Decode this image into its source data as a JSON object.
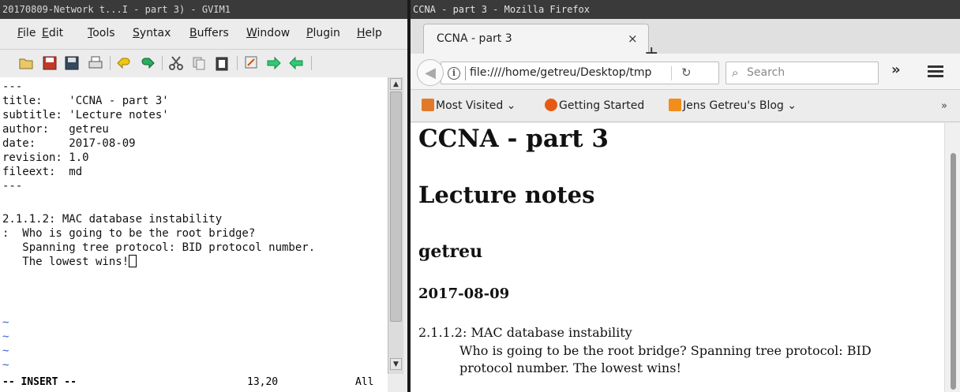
{
  "gvim": {
    "title": "20170809-Network t...I - part 3) - GVIM1",
    "menus": [
      "File",
      "Edit",
      "Tools",
      "Syntax",
      "Buffers",
      "Window",
      "Plugin",
      "Help"
    ],
    "toolbar_icons": [
      "open-icon",
      "save-icon",
      "save-all-icon",
      "print-icon",
      "undo-icon",
      "redo-icon",
      "cut-icon",
      "copy-icon",
      "paste-icon",
      "find-replace-icon",
      "find-next-icon",
      "find-prev-icon"
    ],
    "lines": [
      "---",
      "title:    'CCNA - part 3'",
      "subtitle: 'Lecture notes'",
      "author:   getreu",
      "date:     2017-08-09",
      "revision: 1.0",
      "fileext:  md",
      "---",
      "",
      "2.1.1.2: MAC database instability",
      ":  Who is going to be the root bridge?",
      "   Spanning tree protocol: BID protocol number.",
      "   The lowest wins!"
    ],
    "tildes": [
      "~",
      "~",
      "~",
      "~"
    ],
    "status": {
      "mode": "-- INSERT --",
      "position": "13,20",
      "scroll": "All"
    }
  },
  "firefox": {
    "title": "CCNA - part 3 - Mozilla Firefox",
    "tab_label": "CCNA - part 3",
    "tab_close": "×",
    "new_tab": "+",
    "url": "file:////home/getreu/Desktop/tmp",
    "search_placeholder": "Search",
    "overflow": "»",
    "bookmarks": [
      {
        "label": "Most Visited",
        "icon": "folder-icon",
        "dropdown": true
      },
      {
        "label": "Getting Started",
        "icon": "firefox-icon",
        "dropdown": false
      },
      {
        "label": "Jens Getreu's Blog",
        "icon": "rss-icon",
        "dropdown": true
      }
    ],
    "bookmarks_overflow": "»",
    "document": {
      "title": "CCNA - part 3",
      "subtitle": "Lecture notes",
      "author": "getreu",
      "date": "2017-08-09",
      "term": "2.1.1.2: MAC database instability",
      "definition": "Who is going to be the root bridge? Spanning tree protocol: BID protocol number. The lowest wins!"
    }
  },
  "colors": {
    "titlebar": "#3a3a3a",
    "tilde": "#3a5fcd",
    "rss": "#f28c1b",
    "folder": "#e07a2a"
  }
}
